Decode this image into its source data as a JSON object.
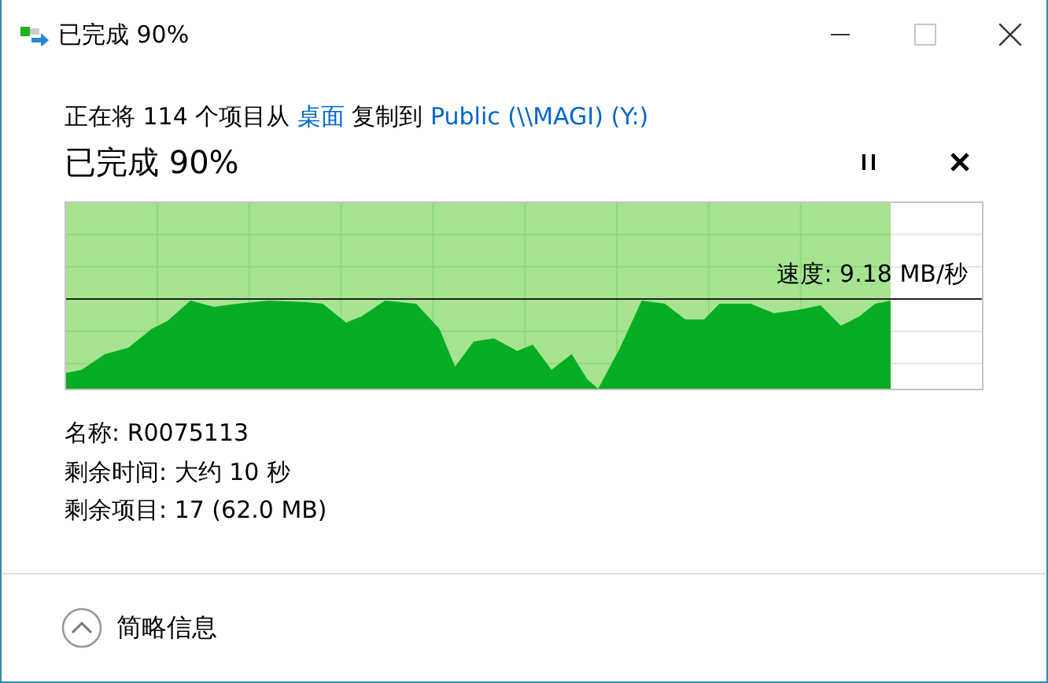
{
  "window": {
    "title": "已完成 90%"
  },
  "message": {
    "before": "正在将 114 个项目从",
    "source": "桌面",
    "middle": "复制到",
    "destination": "Public (\\\\MAGI) (Y:)"
  },
  "progress": {
    "heading": "已完成 90%",
    "level": 0.9,
    "speed": "速度: 9.18 MB/秒"
  },
  "details": [
    "名称: R0075113",
    "剩余时间: 大约 10 秒",
    "剩余项目: 17 (62.0 MB)"
  ],
  "footer": {
    "label": "简略信息",
    "expanded": true
  }
}
